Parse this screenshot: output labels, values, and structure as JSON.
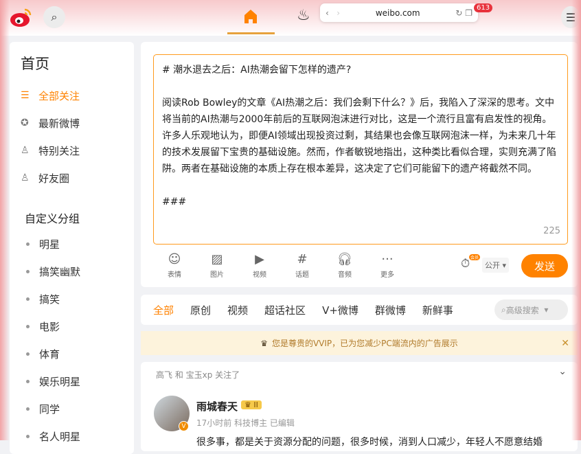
{
  "browser": {
    "url": "weibo.com",
    "badge": "613"
  },
  "sidebar": {
    "title": "首页",
    "items": [
      {
        "label": "全部关注",
        "icon": "list-icon"
      },
      {
        "label": "最新微博",
        "icon": "star-icon"
      },
      {
        "label": "特别关注",
        "icon": "user-star-icon"
      },
      {
        "label": "好友圈",
        "icon": "users-icon"
      }
    ],
    "group_title": "自定义分组",
    "groups": [
      "明星",
      "搞笑幽默",
      "搞笑",
      "电影",
      "体育",
      "娱乐明星",
      "同学",
      "名人明星"
    ]
  },
  "composer": {
    "text": "# 潮水退去之后：AI热潮会留下怎样的遗产?\n\n阅读Rob Bowley的文章《AI热潮之后：我们会剩下什么？》后，我陷入了深深的思考。文中将当前的AI热潮与2000年前后的互联网泡沫进行对比，这是一个流行且富有启发性的视角。许多人乐观地认为，即便AI领域出现投资过剩，其结果也会像互联网泡沫一样，为未来几十年的技术发展留下宝贵的基础设施。然而，作者敏锐地指出，这种类比看似合理，实则充满了陷阱。两者在基础设施的本质上存在根本差异，这决定了它们可能留下的遗产将截然不同。\n\n###",
    "count": "225",
    "tools": [
      "表情",
      "图片",
      "视频",
      "话题",
      "音频",
      "更多"
    ],
    "vip_mini": "会员",
    "visibility": "公开",
    "send": "发送"
  },
  "feed_tabs": [
    "全部",
    "原创",
    "视频",
    "超话社区",
    "V+微博",
    "群微博",
    "新鲜事"
  ],
  "search_placeholder": "高级搜索",
  "vip_notice": "您是尊贵的VVIP，已为您减少PC端流内的广告展示",
  "post": {
    "follow_note": "高飞 和 宝玉xp 关注了",
    "user": "雨城春天",
    "level": "II",
    "meta": "17小时前 科技博主 已编辑",
    "text": "很多事，都是关于资源分配的问题，很多时候，消到人口减少，年轻人不愿意结婚"
  }
}
